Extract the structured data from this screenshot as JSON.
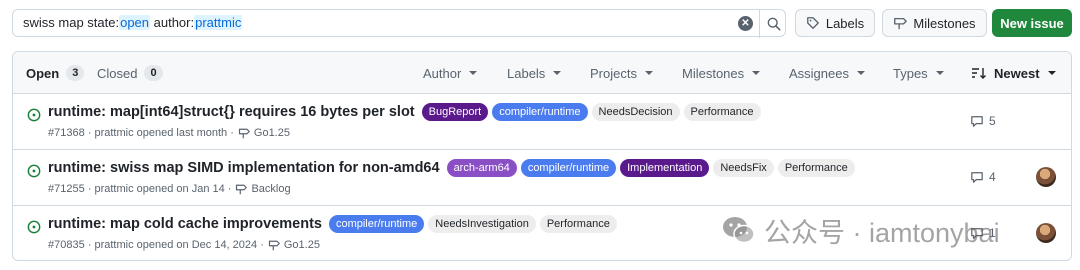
{
  "search": {
    "segments": [
      {
        "text": "swiss map state:",
        "kind": "plain"
      },
      {
        "text": "open",
        "kind": "value"
      },
      {
        "text": " author:",
        "kind": "plain"
      },
      {
        "text": "prattmic",
        "kind": "value"
      }
    ]
  },
  "toolbar": {
    "labels_label": "Labels",
    "milestones_label": "Milestones",
    "new_issue_label": "New issue"
  },
  "list_header": {
    "open_label": "Open",
    "open_count": "3",
    "closed_label": "Closed",
    "closed_count": "0",
    "filters": [
      "Author",
      "Labels",
      "Projects",
      "Milestones",
      "Assignees",
      "Types"
    ],
    "sort_label": "Newest"
  },
  "issues": [
    {
      "title": "runtime: map[int64]struct{} requires 16 bytes per slot",
      "labels": [
        {
          "name": "BugReport",
          "bg": "#5a1a8c",
          "fg": "#ffffff"
        },
        {
          "name": "compiler/runtime",
          "bg": "#4a7cf0",
          "fg": "#ffffff"
        },
        {
          "name": "NeedsDecision",
          "bg": "#ededed",
          "fg": "#1f2328"
        },
        {
          "name": "Performance",
          "bg": "#ededed",
          "fg": "#1f2328"
        }
      ],
      "meta": "#71368 · prattmic opened last month ·",
      "milestone": "Go1.25",
      "comments": "5",
      "has_avatar": false
    },
    {
      "title": "runtime: swiss map SIMD implementation for non-amd64",
      "labels": [
        {
          "name": "arch-arm64",
          "bg": "#8a4fc4",
          "fg": "#ffffff"
        },
        {
          "name": "compiler/runtime",
          "bg": "#4a7cf0",
          "fg": "#ffffff"
        },
        {
          "name": "Implementation",
          "bg": "#5a1a8c",
          "fg": "#ffffff"
        },
        {
          "name": "NeedsFix",
          "bg": "#ededed",
          "fg": "#1f2328"
        },
        {
          "name": "Performance",
          "bg": "#ededed",
          "fg": "#1f2328"
        }
      ],
      "meta": "#71255 · prattmic opened on Jan 14 ·",
      "milestone": "Backlog",
      "comments": "4",
      "has_avatar": true
    },
    {
      "title": "runtime: map cold cache improvements",
      "labels": [
        {
          "name": "compiler/runtime",
          "bg": "#4a7cf0",
          "fg": "#ffffff"
        },
        {
          "name": "NeedsInvestigation",
          "bg": "#ededed",
          "fg": "#1f2328"
        },
        {
          "name": "Performance",
          "bg": "#ededed",
          "fg": "#1f2328"
        }
      ],
      "meta": "#70835 · prattmic opened on Dec 14, 2024 ·",
      "milestone": "Go1.25",
      "comments": "1",
      "has_avatar": true
    }
  ],
  "watermark": {
    "text": "公众号 · iamtonybai"
  },
  "colors": {
    "open_icon": "#1a7f37",
    "primary_button": "#1f883d",
    "search_token": "#0969da"
  },
  "icons": [
    "search-icon",
    "close-icon",
    "tag-icon",
    "milestone-icon",
    "issue-open-icon",
    "comment-icon",
    "sort-icon",
    "chevron-down-icon"
  ]
}
